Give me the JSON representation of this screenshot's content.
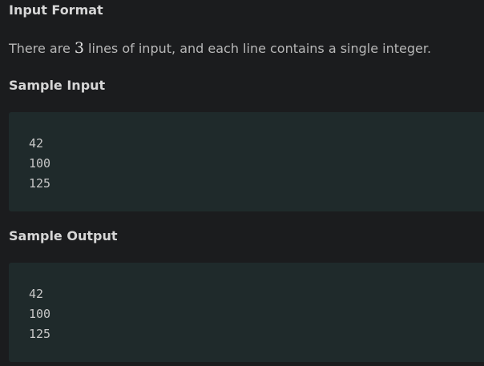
{
  "input_format": {
    "heading": "Input Format",
    "text_before": "There are ",
    "number": "3",
    "text_after": " lines of input, and each line contains a single integer."
  },
  "sample_input": {
    "heading": "Sample Input",
    "lines": [
      "42",
      "100",
      "125"
    ]
  },
  "sample_output": {
    "heading": "Sample Output",
    "lines": [
      "42",
      "100",
      "125"
    ]
  }
}
